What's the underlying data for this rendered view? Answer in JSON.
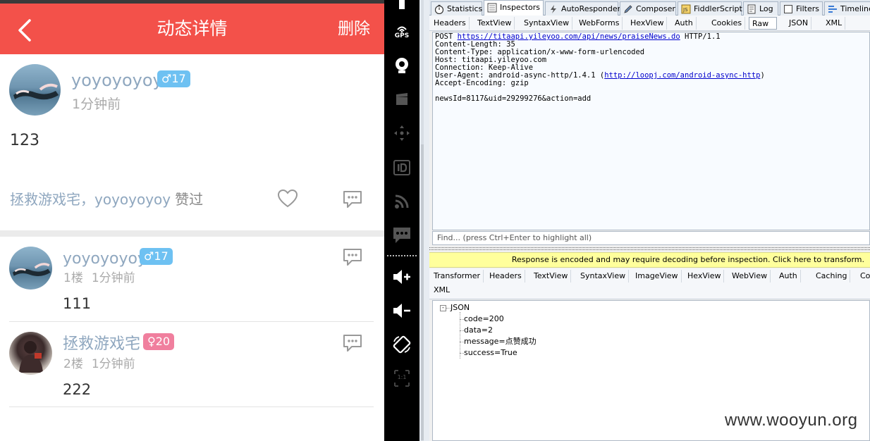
{
  "phone": {
    "header": {
      "title": "动态详情",
      "delete_label": "删除"
    },
    "post": {
      "author": "yoyoyoyoy",
      "gender_badge": "♂17",
      "time": "1分钟前",
      "content": "123",
      "likers": "拯救游戏宅，yoyoyoyoy",
      "likers_suffix": "赞过"
    },
    "comments": [
      {
        "author": "yoyoyoyoy",
        "gender_badge": "♂17",
        "floor": "1楼",
        "time": "1分钟前",
        "content": "111"
      },
      {
        "author": "拯救游戏宅",
        "gender_badge": "♀20",
        "floor": "2楼",
        "time": "1分钟前",
        "content": "222"
      }
    ]
  },
  "emulator_toolbar": {
    "gps_label": "GPS",
    "ratio_label": "1:1",
    "buttons": [
      "gps-icon",
      "webcam-icon",
      "clapper-icon",
      "dpad-icon",
      "id-icon",
      "rss-icon",
      "sms-icon",
      "volume-up-icon",
      "volume-down-icon",
      "rotate-icon",
      "fit-ratio-icon"
    ]
  },
  "fiddler": {
    "top_tabs": [
      "Statistics",
      "Inspectors",
      "AutoResponder",
      "Composer",
      "FiddlerScript",
      "Log",
      "Filters",
      "Timeline"
    ],
    "request_tabs": [
      "Headers",
      "TextView",
      "SyntaxView",
      "WebForms",
      "HexView",
      "Auth",
      "Cookies",
      "Raw",
      "JSON",
      "XML"
    ],
    "request_raw": {
      "request_line_method": "POST",
      "request_line_url": "https://titaapi.yileyoo.com/api/news/praiseNews.do",
      "request_line_version": "HTTP/1.1",
      "content_length": "Content-Length: 35",
      "content_type": "Content-Type: application/x-www-form-urlencoded",
      "host": "Host: titaapi.yileyoo.com",
      "connection": "Connection: Keep-Alive",
      "user_agent_prefix": "User-Agent: android-async-http/1.4.1 (",
      "user_agent_link": "http://loopj.com/android-async-http",
      "user_agent_suffix": ")",
      "accept_encoding": "Accept-Encoding: gzip",
      "body": "newsId=8117&uid=29299276&action=add"
    },
    "find_placeholder": "Find... (press Ctrl+Enter to highlight all)",
    "notice": "Response is encoded and may require decoding before inspection. Click here to transform.",
    "response_tabs": [
      "Transformer",
      "Headers",
      "TextView",
      "SyntaxView",
      "ImageView",
      "HexView",
      "WebView",
      "Auth",
      "Caching",
      "Coo",
      "XML"
    ],
    "json_tree": {
      "root": "JSON",
      "toggle": "-",
      "children": [
        "code=200",
        "data=2",
        "message=点赞成功",
        "success=True"
      ]
    }
  },
  "watermark": "www.wooyun.org"
}
